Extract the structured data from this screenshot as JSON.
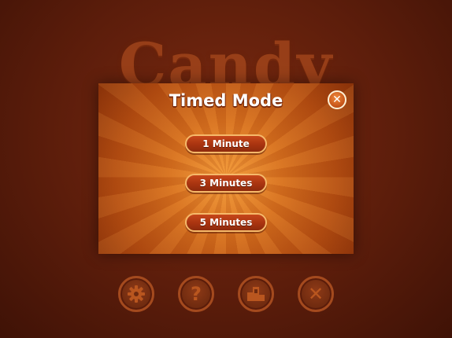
{
  "background": {
    "title": "Candy",
    "buttons": [
      {
        "icon": "gear-icon"
      },
      {
        "icon": "question-icon",
        "glyph": "?"
      },
      {
        "icon": "leaderboard-icon"
      },
      {
        "icon": "close-icon",
        "glyph": "✕"
      }
    ]
  },
  "modal": {
    "title": "Timed Mode",
    "close_glyph": "✕",
    "options": [
      {
        "label": "1 Minute"
      },
      {
        "label": "3 Minutes"
      },
      {
        "label": "5 Minutes"
      }
    ]
  },
  "colors": {
    "backdrop": "#5a1c0a",
    "panel_center": "#f39a3a",
    "panel_edge": "#8a320a",
    "button_fill": "#a83410",
    "button_border": "#f6b96a",
    "text": "#ffffff"
  }
}
